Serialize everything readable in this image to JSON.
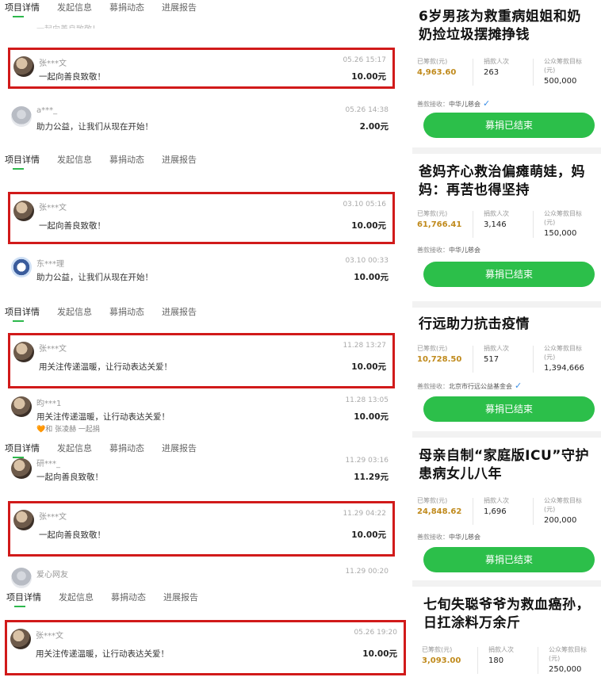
{
  "tabs": [
    "项目详情",
    "发起信息",
    "募捐动态",
    "进展报告"
  ],
  "left_sections": [
    {
      "top_fragment": "一起向善良致敬！",
      "entries": [
        {
          "name": "张***文",
          "time": "05.26 15:17",
          "message": "一起向善良致敬！",
          "amount": "10.00元",
          "highlighted": true
        },
        {
          "name": "a***_",
          "time": "05.26 14:38",
          "message": "助力公益，让我们从现在开始！",
          "amount": "2.00元",
          "highlighted": false
        }
      ]
    },
    {
      "entries": [
        {
          "name": "张***文",
          "time": "03.10 05:16",
          "message": "一起向善良致敬！",
          "amount": "10.00元",
          "highlighted": true
        },
        {
          "name": "东***理",
          "time": "03.10 00:33",
          "message": "助力公益，让我们从现在开始！",
          "amount": "10.00元",
          "highlighted": false
        }
      ]
    },
    {
      "entries": [
        {
          "name": "张***文",
          "time": "11.28 13:27",
          "message": "用关注传递温暖，让行动表达关爱！",
          "amount": "10.00元",
          "highlighted": true
        },
        {
          "name": "昀***1",
          "time": "11.28 13:05",
          "message": "用关注传递温暖，让行动表达关爱！",
          "amount": "10.00元",
          "highlighted": false,
          "extra": "🧡和 张凌赫 一起捐"
        }
      ]
    },
    {
      "entries": [
        {
          "name": "研***_",
          "time": "11.29 03:16",
          "message": "一起向善良致敬！",
          "amount": "11.29元",
          "highlighted": false
        },
        {
          "name": "张***文",
          "time": "11.29 04:22",
          "message": "一起向善良致敬！",
          "amount": "10.00元",
          "highlighted": true
        },
        {
          "name": "爱心网友",
          "time": "11.29 00:20",
          "message": "",
          "amount": "",
          "highlighted": false
        }
      ]
    },
    {
      "entries": [
        {
          "name": "张***文",
          "time": "05.26 19:20",
          "message": "用关注传递温暖，让行动表达关爱！",
          "amount": "10.00元",
          "highlighted": true
        }
      ]
    }
  ],
  "cards": [
    {
      "title": "6岁男孩为救重病姐姐和奶奶捡垃圾摆摊挣钱",
      "raised_label": "已筹款(元)",
      "raised": "4,963.60",
      "donors_label": "捐款人次",
      "donors": "263",
      "target_label": "公众筹款目标(元)",
      "target": "500,000",
      "org_label": "善款接收：",
      "org": "中华儿慈会",
      "button": "募捐已结束"
    },
    {
      "title": "爸妈齐心救治偏瘫萌娃，妈妈：再苦也得坚持",
      "raised_label": "已筹款(元)",
      "raised": "61,766.41",
      "donors_label": "捐款人次",
      "donors": "3,146",
      "target_label": "公众筹款目标(元)",
      "target": "150,000",
      "org_label": "善款接收：",
      "org": "中华儿慈会",
      "button": "募捐已结束"
    },
    {
      "title": "行远助力抗击疫情",
      "raised_label": "已筹款(元)",
      "raised": "10,728.50",
      "donors_label": "捐款人次",
      "donors": "517",
      "target_label": "公众筹款目标(元)",
      "target": "1,394,666",
      "org_label": "善款接收：",
      "org": "北京市行远公益基金会",
      "button": "募捐已结束"
    },
    {
      "title": "母亲自制“家庭版ICU”守护患病女儿八年",
      "raised_label": "已筹款(元)",
      "raised": "24,848.62",
      "donors_label": "捐款人次",
      "donors": "1,696",
      "target_label": "公众筹款目标(元)",
      "target": "200,000",
      "org_label": "善款接收：",
      "org": "中华儿慈会",
      "button": "募捐已结束"
    },
    {
      "title": "七旬失聪爷爷为救血癌孙，日扛涂料万余斤",
      "raised_label": "已筹款(元)",
      "raised": "3,093.00",
      "donors_label": "捐款人次",
      "donors": "180",
      "target_label": "公众筹款目标(元)",
      "target": "250,000"
    }
  ],
  "colors": {
    "accent_green": "#2cbf4a",
    "highlight_red": "#d11a1a",
    "amount_gold": "#c08a1c",
    "verify_blue": "#3a8ee6"
  },
  "icons": {
    "verified": "check-icon"
  }
}
